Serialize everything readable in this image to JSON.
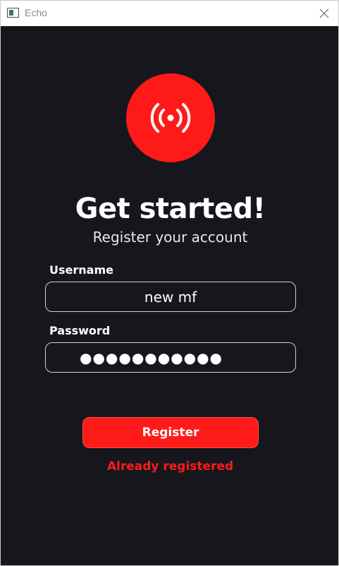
{
  "window": {
    "title": "Echo",
    "app_icon": "app-window-icon",
    "close_icon": "close-icon"
  },
  "logo": {
    "icon": "broadcast-icon",
    "color": "#ff1a1a"
  },
  "heading": {
    "title": "Get started!",
    "subtitle": "Register your account"
  },
  "form": {
    "username": {
      "label": "Username",
      "value": "new mf"
    },
    "password": {
      "label": "Password",
      "masked": "●●●●●●●●●●●"
    },
    "register_button": "Register"
  },
  "status": {
    "message": "Already registered",
    "color": "#ff1a1a"
  },
  "colors": {
    "background": "#16171c",
    "accent": "#ff1a1a",
    "text": "#ffffff"
  }
}
